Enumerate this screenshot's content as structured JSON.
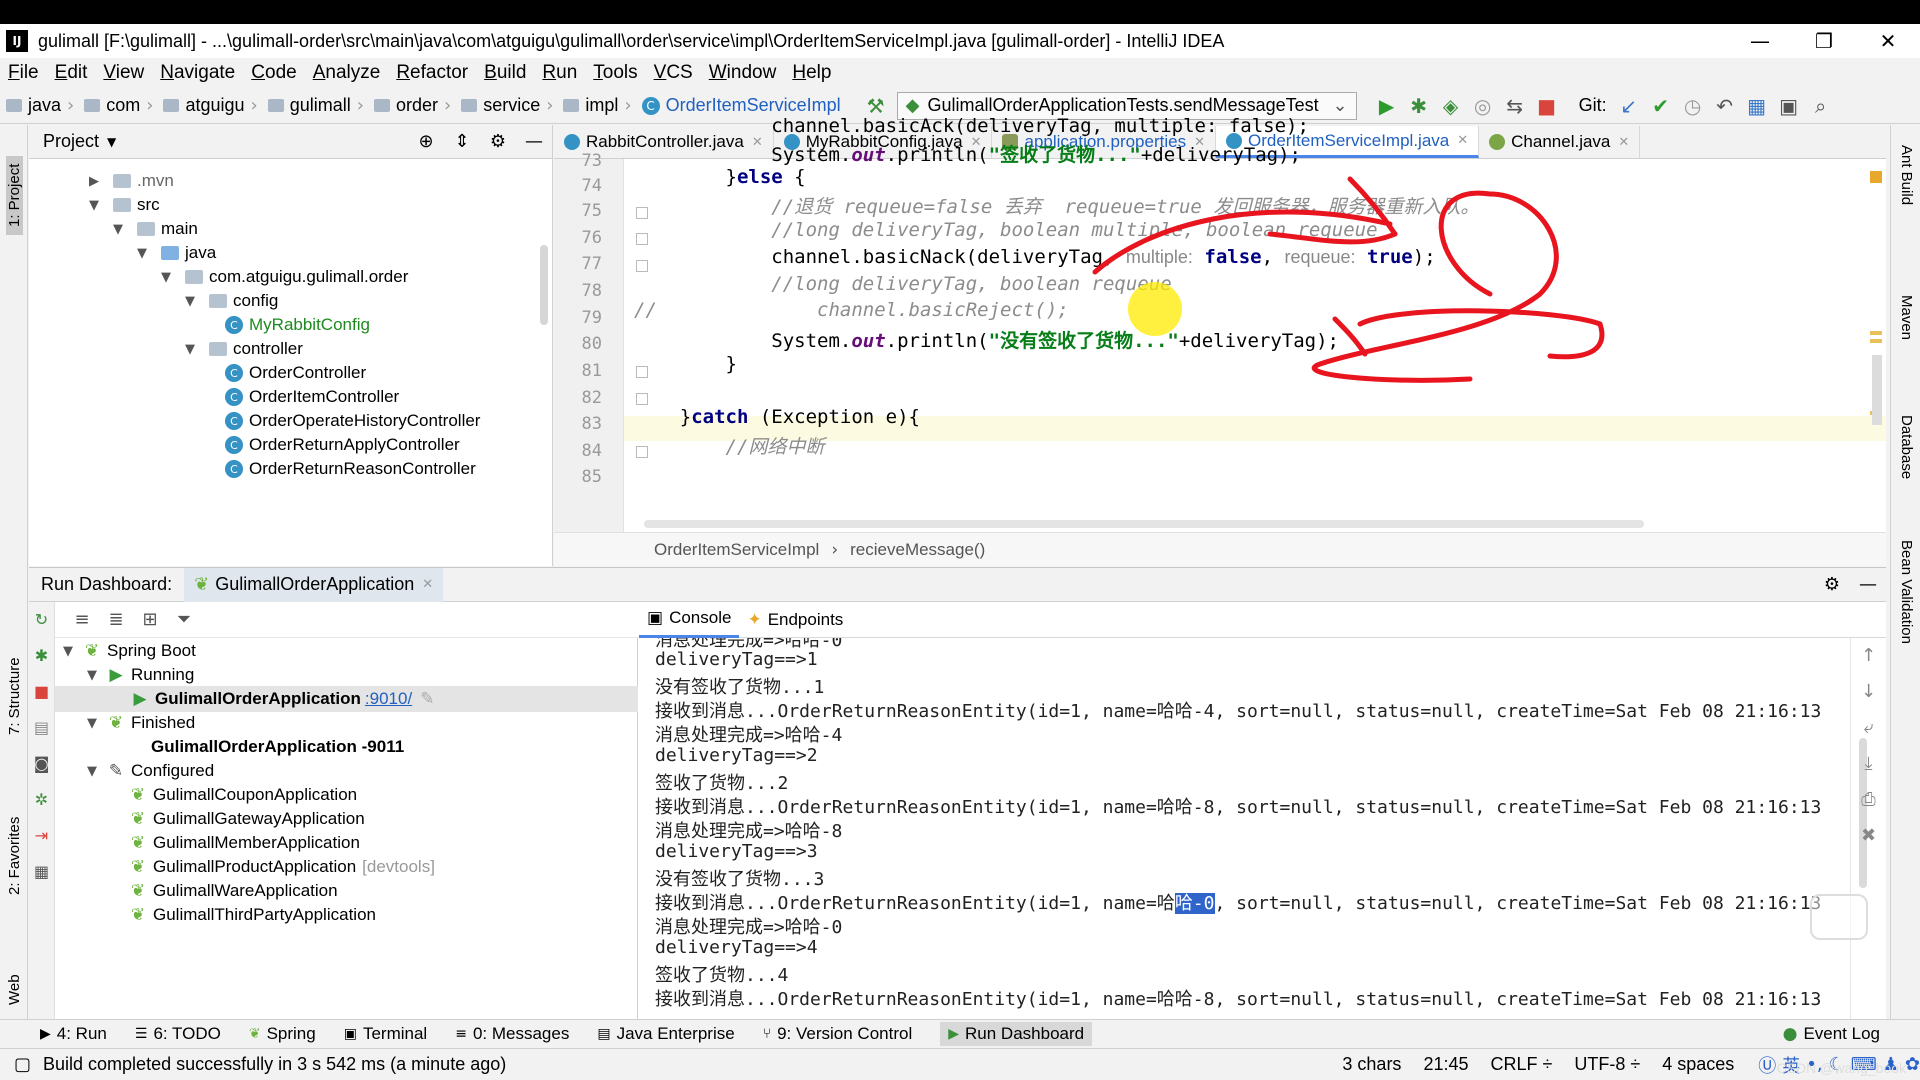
{
  "window": {
    "title": "gulimall [F:\\gulimall] - ...\\gulimall-order\\src\\main\\java\\com\\atguigu\\gulimall\\order\\service\\impl\\OrderItemServiceImpl.java [gulimall-order] - IntelliJ IDEA",
    "logo": "IJ"
  },
  "menu": [
    "File",
    "Edit",
    "View",
    "Navigate",
    "Code",
    "Analyze",
    "Refactor",
    "Build",
    "Run",
    "Tools",
    "VCS",
    "Window",
    "Help"
  ],
  "breadcrumbs": [
    "java",
    "com",
    "atguigu",
    "gulimall",
    "order",
    "service",
    "impl"
  ],
  "breadcrumb_active": "OrderItemServiceImpl",
  "run_config": "GulimallOrderApplicationTests.sendMessageTest",
  "git_label": "Git:",
  "project": {
    "title": "Project",
    "tree": [
      {
        "label": ".mvn",
        "kind": "folder"
      },
      {
        "label": "src",
        "kind": "folder"
      },
      {
        "label": "main",
        "kind": "folder"
      },
      {
        "label": "java",
        "kind": "folder-blue"
      },
      {
        "label": "com.atguigu.gulimall.order",
        "kind": "package"
      },
      {
        "label": "config",
        "kind": "package"
      },
      {
        "label": "MyRabbitConfig",
        "kind": "class-green"
      },
      {
        "label": "controller",
        "kind": "package"
      },
      {
        "label": "OrderController",
        "kind": "class"
      },
      {
        "label": "OrderItemController",
        "kind": "class"
      },
      {
        "label": "OrderOperateHistoryController",
        "kind": "class"
      },
      {
        "label": "OrderReturnApplyController",
        "kind": "class"
      },
      {
        "label": "OrderReturnReasonController",
        "kind": "class"
      }
    ]
  },
  "editor": {
    "tabs": [
      "RabbitController.java",
      "MyRabbitConfig.java",
      "application.properties",
      "OrderItemServiceImpl.java",
      "Channel.java"
    ],
    "active_tab": "OrderItemServiceImpl.java",
    "line_numbers": [
      "73",
      "74",
      "75",
      "76",
      "77",
      "78",
      "79",
      "80",
      "81",
      "82",
      "83",
      "84",
      "85"
    ],
    "code": {
      "l73": "            channel.basicAck(deliveryTag, multiple: false);",
      "l74a": "            System.",
      "l74b": "out",
      "l74c": ".println(",
      "l74d": "\"签收了货物...\"",
      "l74e": "+deliveryTag);",
      "l75a": "        }",
      "l75b": "else",
      "l75c": " {",
      "l76": "            //退货 requeue=false 丢弃  requeue=true 发回服务器，服务器重新入队。",
      "l77": "            //long deliveryTag, boolean multiple, boolean requeue",
      "l78a": "            channel.basicNack(deliveryTag, ",
      "l78b": "multiple:",
      "l78c": "false",
      "l78d": ", ",
      "l78e": "requeue:",
      "l78f": "true",
      "l78g": ");",
      "l79": "            //long deliveryTag, boolean requeue",
      "l80a": "//",
      "l80b": "              channel.basicReject();",
      "l81a": "            System.",
      "l81b": "out",
      "l81c": ".println(",
      "l81d": "\"没有签收了货物...\"",
      "l81e": "+deliveryTag);",
      "l82": "        }",
      "l83": "",
      "l84a": "    }",
      "l84b": "catch",
      "l84c": " (Exception e){",
      "l85": "        //网络中断"
    },
    "footer_crumbs": [
      "OrderItemServiceImpl",
      "recieveMessage()"
    ]
  },
  "run_dashboard": {
    "title": "Run Dashboard:",
    "app_tab": "GulimallOrderApplication",
    "tree": {
      "spring_boot": "Spring Boot",
      "running": "Running",
      "running_app": "GulimallOrderApplication",
      "running_port": ":9010/",
      "finished": "Finished",
      "finished_app": "GulimallOrderApplication -9011",
      "configured": "Configured",
      "configured_apps": [
        {
          "name": "GulimallCouponApplication",
          "tag": ""
        },
        {
          "name": "GulimallGatewayApplication",
          "tag": ""
        },
        {
          "name": "GulimallMemberApplication",
          "tag": ""
        },
        {
          "name": "GulimallProductApplication",
          "tag": "[devtools]"
        },
        {
          "name": "GulimallWareApplication",
          "tag": ""
        },
        {
          "name": "GulimallThirdPartyApplication",
          "tag": ""
        }
      ]
    },
    "console_tabs": [
      "Console",
      "Endpoints"
    ],
    "console_lines": [
      "消息处理完成=>哈哈-0",
      "deliveryTag==>1",
      "没有签收了货物...1",
      "接收到消息...OrderReturnReasonEntity(id=1, name=哈哈-4, sort=null, status=null, createTime=Sat Feb 08 21:16:13",
      "消息处理完成=>哈哈-4",
      "deliveryTag==>2",
      "签收了货物...2",
      "接收到消息...OrderReturnReasonEntity(id=1, name=哈哈-8, sort=null, status=null, createTime=Sat Feb 08 21:16:13",
      "消息处理完成=>哈哈-8",
      "deliveryTag==>3",
      "没有签收了货物...3",
      "",
      "消息处理完成=>哈哈-0",
      "deliveryTag==>4",
      "签收了货物...4",
      "接收到消息...OrderReturnReasonEntity(id=1, name=哈哈-8, sort=null, status=null, createTime=Sat Feb 08 21:16:13"
    ],
    "console_sel_line": {
      "pre": "接收到消息...OrderReturnReasonEntity(id=1, name=哈",
      "sel": "哈-0",
      "post": ", sort=null, status=null, createTime=Sat Feb 08 21:16:13"
    }
  },
  "bottom_tools": [
    {
      "label": "4: Run",
      "icon": "play-icon"
    },
    {
      "label": "6: TODO",
      "icon": "list-icon"
    },
    {
      "label": "Spring",
      "icon": "leaf-icon"
    },
    {
      "label": "Terminal",
      "icon": "terminal-icon"
    },
    {
      "label": "0: Messages",
      "icon": "messages-icon"
    },
    {
      "label": "Java Enterprise",
      "icon": "enterprise-icon"
    },
    {
      "label": "9: Version Control",
      "icon": "vcs-icon"
    },
    {
      "label": "Run Dashboard",
      "icon": "dashboard-icon"
    }
  ],
  "event_log": "Event Log",
  "status": {
    "message": "Build completed successfully in 3 s 542 ms (a minute ago)",
    "chars": "3 chars",
    "position": "21:45",
    "line_sep": "CRLF ÷",
    "encoding": "UTF-8 ÷",
    "indent": "4 spaces",
    "ime": "英"
  },
  "side_labels": {
    "left": [
      "1: Project",
      "7: Structure",
      "2: Favorites",
      "Web"
    ],
    "right": [
      "Ant Build",
      "Maven",
      "Database",
      "Bean Validation"
    ]
  },
  "watermark": "CSDN @wang_book",
  "colors": {
    "accent": "#4a86e8",
    "annotation": "#e8141e",
    "highlight": "#ffeb00"
  }
}
